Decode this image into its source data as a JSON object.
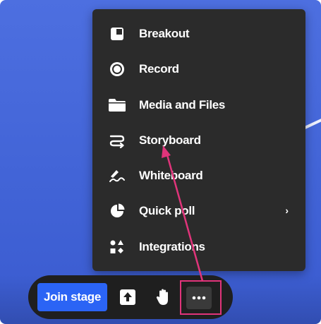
{
  "menu": {
    "items": [
      {
        "label": "Breakout",
        "icon": "breakout-icon"
      },
      {
        "label": "Record",
        "icon": "record-icon"
      },
      {
        "label": "Media and Files",
        "icon": "folder-icon"
      },
      {
        "label": "Storyboard",
        "icon": "storyboard-icon"
      },
      {
        "label": "Whiteboard",
        "icon": "whiteboard-icon"
      },
      {
        "label": "Quick poll",
        "icon": "pie-chart-icon",
        "chevron": "›"
      },
      {
        "label": "Integrations",
        "icon": "integrations-icon"
      }
    ]
  },
  "toolbar": {
    "join_label": "Join stage",
    "share_icon": "upload-icon",
    "hand_icon": "raise-hand-icon",
    "more_icon": "more-dots-icon"
  },
  "colors": {
    "stage_bg": "#4163d6",
    "menu_bg": "#2b2b2b",
    "join_button": "#2b64f5",
    "annotation": "#e0347a"
  }
}
